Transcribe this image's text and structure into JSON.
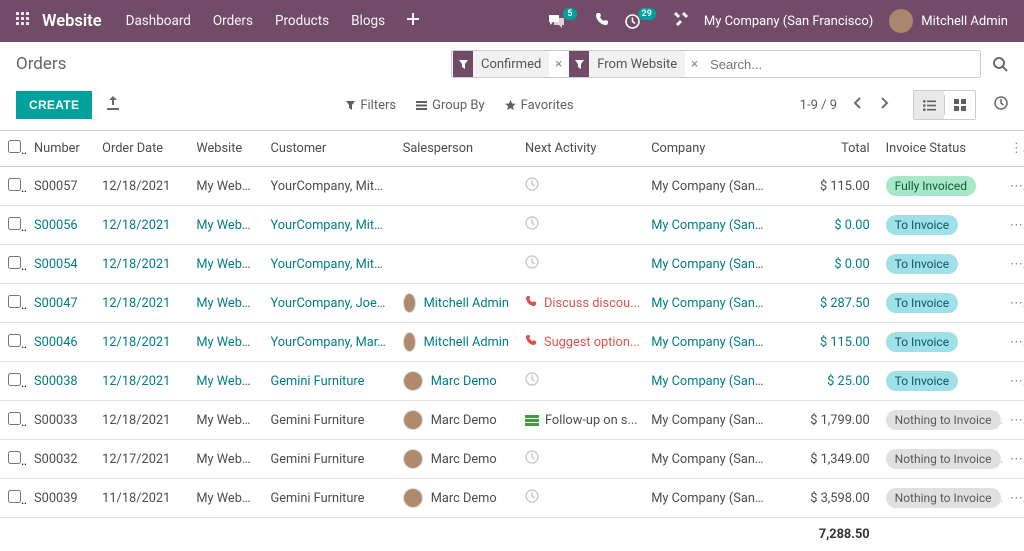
{
  "topbar": {
    "brand": "Website",
    "nav": [
      "Dashboard",
      "Orders",
      "Products",
      "Blogs"
    ],
    "msg_count": "5",
    "activity_count": "29",
    "company": "My Company (San Francisco)",
    "user": "Mitchell Admin"
  },
  "page": {
    "title": "Orders",
    "create": "CREATE",
    "filters_label": "Filters",
    "groupby_label": "Group By",
    "favorites_label": "Favorites",
    "pager": "1-9 / 9",
    "search_placeholder": "Search...",
    "filter_chips": [
      "Confirmed",
      "From Website"
    ]
  },
  "table": {
    "headers": {
      "number": "Number",
      "date": "Order Date",
      "website": "Website",
      "customer": "Customer",
      "sales": "Salesperson",
      "activity": "Next Activity",
      "company": "Company",
      "total": "Total",
      "status": "Invoice Status"
    },
    "rows": [
      {
        "num": "S00057",
        "date": "12/18/2021",
        "site": "My Websi...",
        "cust": "YourCompany, Mitc...",
        "sales": "",
        "act_type": "none",
        "act_text": "",
        "comp": "My Company (San ...",
        "total": "$ 115.00",
        "status": "Fully Invoiced",
        "status_cls": "status-fully",
        "muted": true
      },
      {
        "num": "S00056",
        "date": "12/18/2021",
        "site": "My Websi...",
        "cust": "YourCompany, Mitc...",
        "sales": "",
        "act_type": "none",
        "act_text": "",
        "comp": "My Company (San ...",
        "total": "$ 0.00",
        "status": "To Invoice",
        "status_cls": "status-to",
        "muted": false
      },
      {
        "num": "S00054",
        "date": "12/18/2021",
        "site": "My Websi...",
        "cust": "YourCompany, Mitc...",
        "sales": "",
        "act_type": "none",
        "act_text": "",
        "comp": "My Company (San ...",
        "total": "$ 0.00",
        "status": "To Invoice",
        "status_cls": "status-to",
        "muted": false
      },
      {
        "num": "S00047",
        "date": "12/18/2021",
        "site": "My Websi...",
        "cust": "YourCompany, Joel ...",
        "sales": "Mitchell Admin",
        "act_type": "phone",
        "act_text": "Discuss discou...",
        "comp": "My Company (San ...",
        "total": "$ 287.50",
        "status": "To Invoice",
        "status_cls": "status-to",
        "muted": false
      },
      {
        "num": "S00046",
        "date": "12/18/2021",
        "site": "My Websi...",
        "cust": "YourCompany, Mar...",
        "sales": "Mitchell Admin",
        "act_type": "phone",
        "act_text": "Suggest option...",
        "comp": "My Company (San ...",
        "total": "$ 115.00",
        "status": "To Invoice",
        "status_cls": "status-to",
        "muted": false
      },
      {
        "num": "S00038",
        "date": "12/18/2021",
        "site": "My Websi...",
        "cust": "Gemini Furniture",
        "sales": "Marc Demo",
        "act_type": "none",
        "act_text": "",
        "comp": "My Company (San ...",
        "total": "$ 25.00",
        "status": "To Invoice",
        "status_cls": "status-to",
        "muted": false
      },
      {
        "num": "S00033",
        "date": "12/18/2021",
        "site": "My Websi...",
        "cust": "Gemini Furniture",
        "sales": "Marc Demo",
        "act_type": "task",
        "act_text": "Follow-up on s...",
        "comp": "My Company (San ...",
        "total": "$ 1,799.00",
        "status": "Nothing to Invoice",
        "status_cls": "status-nothing",
        "muted": true
      },
      {
        "num": "S00032",
        "date": "12/17/2021",
        "site": "My Websi...",
        "cust": "Gemini Furniture",
        "sales": "Marc Demo",
        "act_type": "none",
        "act_text": "",
        "comp": "My Company (San ...",
        "total": "$ 1,349.00",
        "status": "Nothing to Invoice",
        "status_cls": "status-nothing",
        "muted": true
      },
      {
        "num": "S00039",
        "date": "11/18/2021",
        "site": "My Websi...",
        "cust": "Gemini Furniture",
        "sales": "Marc Demo",
        "act_type": "none",
        "act_text": "",
        "comp": "My Company (San ...",
        "total": "$ 3,598.00",
        "status": "Nothing to Invoice",
        "status_cls": "status-nothing",
        "muted": true
      }
    ],
    "total_sum": "7,288.50"
  }
}
